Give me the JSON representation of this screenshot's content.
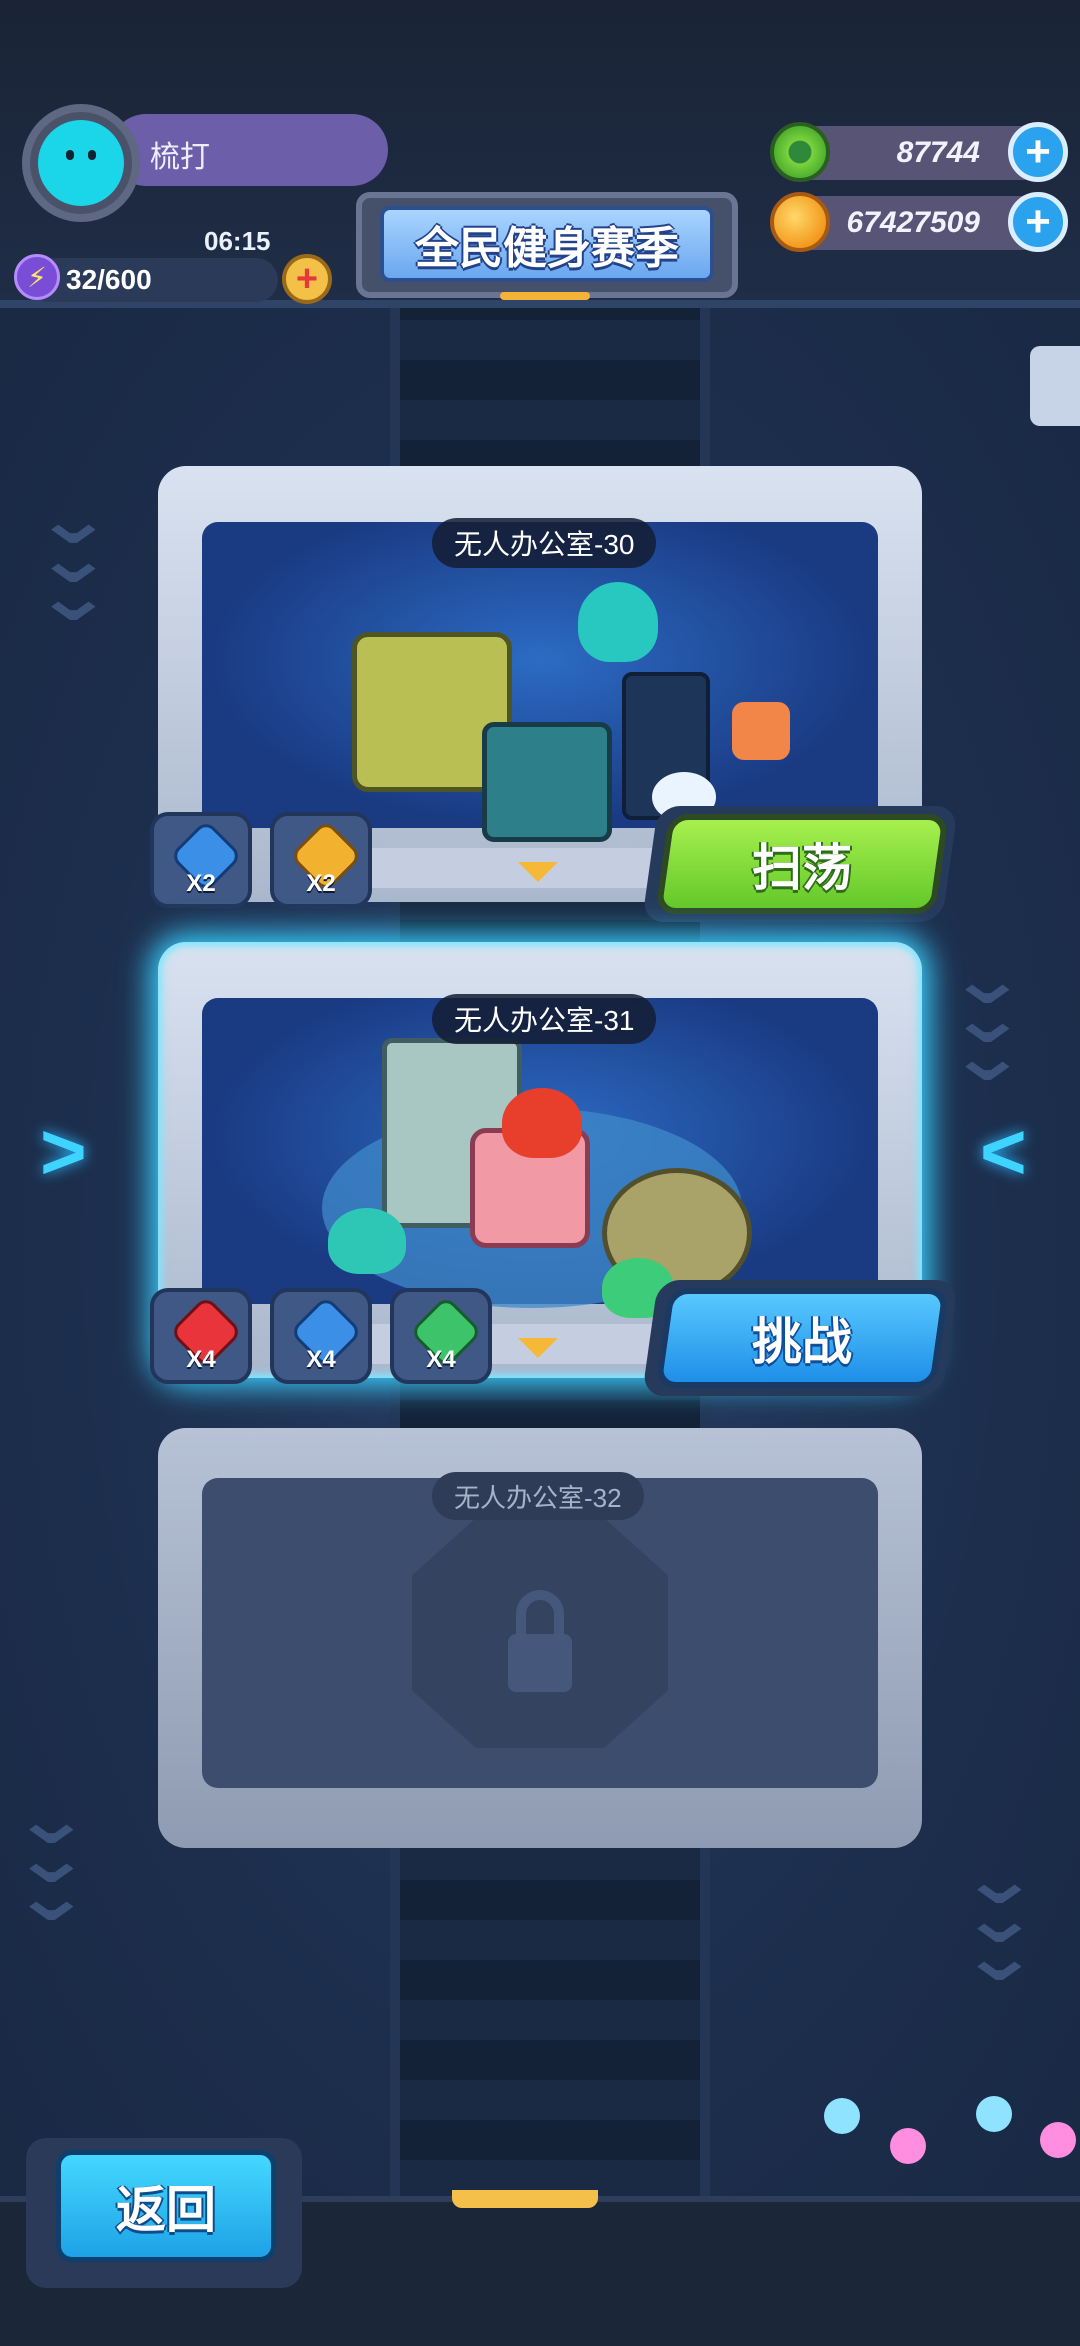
{
  "player": {
    "name": "梳打",
    "timer": "06:15",
    "energy": "32/600"
  },
  "season": {
    "title": "全民健身赛季"
  },
  "resources": [
    {
      "icon": "green-gem-coin-icon",
      "value": "87744"
    },
    {
      "icon": "gold-planet-coin-icon",
      "value": "67427509"
    }
  ],
  "stages": [
    {
      "name": "无人办公室-30",
      "status": "cleared",
      "action": "扫荡",
      "rewards": [
        {
          "icon": "blue-gem-icon",
          "count": "X2"
        },
        {
          "icon": "gold-star-gem-icon",
          "count": "X2"
        }
      ]
    },
    {
      "name": "无人办公室-31",
      "status": "current",
      "action": "挑战",
      "rewards": [
        {
          "icon": "red-gem-icon",
          "count": "X4"
        },
        {
          "icon": "blue-gem-icon",
          "count": "X4"
        },
        {
          "icon": "green-gem-icon",
          "count": "X4"
        }
      ]
    },
    {
      "name": "无人办公室-32",
      "status": "locked"
    }
  ],
  "back_label": "返回",
  "colors": {
    "accent_cyan": "#3fd4ff",
    "sweep_green": "#7fdc3a",
    "challenge_blue": "#2aa2ee"
  }
}
